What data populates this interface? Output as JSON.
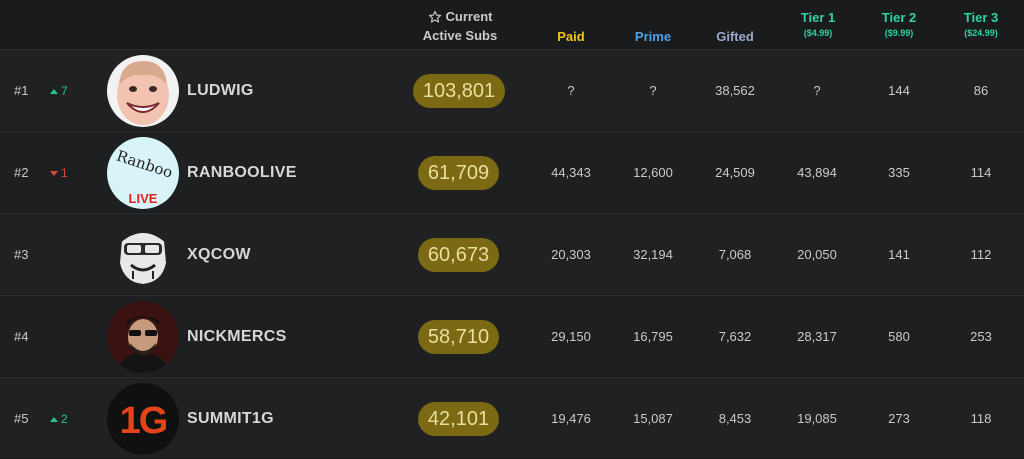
{
  "header": {
    "current_line1": "Current",
    "current_line2": "Active Subs",
    "paid": "Paid",
    "prime": "Prime",
    "gifted": "Gifted",
    "tier1": "Tier 1",
    "tier1_price": "($4.99)",
    "tier2": "Tier 2",
    "tier2_price": "($9.99)",
    "tier3": "Tier 3",
    "tier3_price": "($24.99)"
  },
  "colors": {
    "paid": "#f0c419",
    "prime": "#4aa3e8",
    "gifted": "#9aa8c9",
    "tier": "#2ed3a2",
    "pill_bg": "#7b6914",
    "up": "#27c48a",
    "down": "#e2453c"
  },
  "avatar_text": {
    "ranboo_line1": "Ranboo",
    "ranboo_line2": "LIVE",
    "summit": "1G"
  },
  "rows": [
    {
      "rank": "#1",
      "change": "7",
      "direction": "up",
      "name": "LUDWIG",
      "current": "103,801",
      "paid": "?",
      "prime": "?",
      "gifted": "38,562",
      "tier1": "?",
      "tier2": "144",
      "tier3": "86"
    },
    {
      "rank": "#2",
      "change": "1",
      "direction": "down",
      "name": "RANBOOLIVE",
      "current": "61,709",
      "paid": "44,343",
      "prime": "12,600",
      "gifted": "24,509",
      "tier1": "43,894",
      "tier2": "335",
      "tier3": "114"
    },
    {
      "rank": "#3",
      "change": "",
      "direction": "none",
      "name": "XQCOW",
      "current": "60,673",
      "paid": "20,303",
      "prime": "32,194",
      "gifted": "7,068",
      "tier1": "20,050",
      "tier2": "141",
      "tier3": "112"
    },
    {
      "rank": "#4",
      "change": "",
      "direction": "none",
      "name": "NICKMERCS",
      "current": "58,710",
      "paid": "29,150",
      "prime": "16,795",
      "gifted": "7,632",
      "tier1": "28,317",
      "tier2": "580",
      "tier3": "253"
    },
    {
      "rank": "#5",
      "change": "2",
      "direction": "up",
      "name": "SUMMIT1G",
      "current": "42,101",
      "paid": "19,476",
      "prime": "15,087",
      "gifted": "8,453",
      "tier1": "19,085",
      "tier2": "273",
      "tier3": "118"
    }
  ]
}
